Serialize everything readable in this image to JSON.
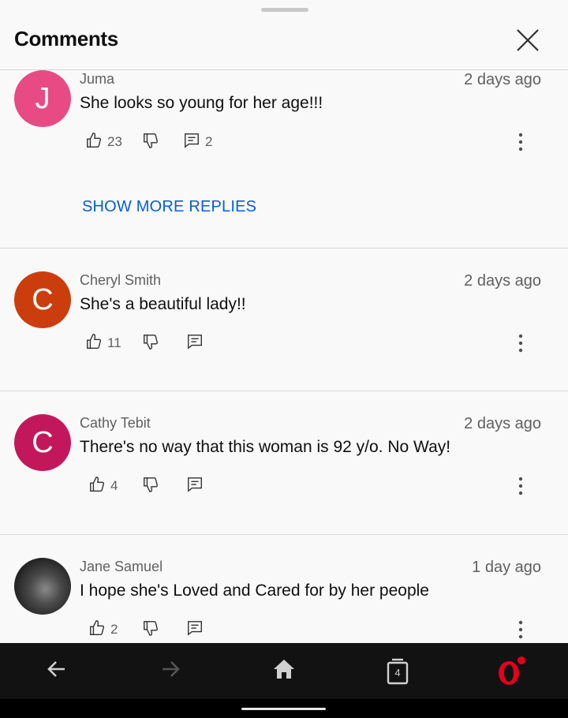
{
  "header": {
    "title": "Comments"
  },
  "comments": [
    {
      "author": "Juma",
      "time": "2 days ago",
      "text": "She looks so young for her age!!!",
      "avatar_letter": "J",
      "avatar_color": "#e84a84",
      "likes": "23",
      "replies": "2"
    },
    {
      "author": "Cheryl Smith",
      "time": "2 days ago",
      "text": "She's a beautiful lady!!",
      "avatar_letter": "C",
      "avatar_color": "#cc3d0e",
      "likes": "11",
      "replies": ""
    },
    {
      "author": "Cathy Tebit",
      "time": "2 days ago",
      "text": "There's no way that this woman is 92 y/o. No Way!",
      "avatar_letter": "C",
      "avatar_color": "#c2185b",
      "likes": "4",
      "replies": ""
    },
    {
      "author": "Jane Samuel",
      "time": "1 day ago",
      "text": "I hope she's Loved and Cared for by her people",
      "avatar_letter": "",
      "avatar_color": "#3a3a3a",
      "likes": "2",
      "replies": ""
    }
  ],
  "show_more_replies": "SHOW MORE REPLIES",
  "bottom_bar": {
    "tabs_count": "4",
    "brand_color": "#e3001b"
  }
}
